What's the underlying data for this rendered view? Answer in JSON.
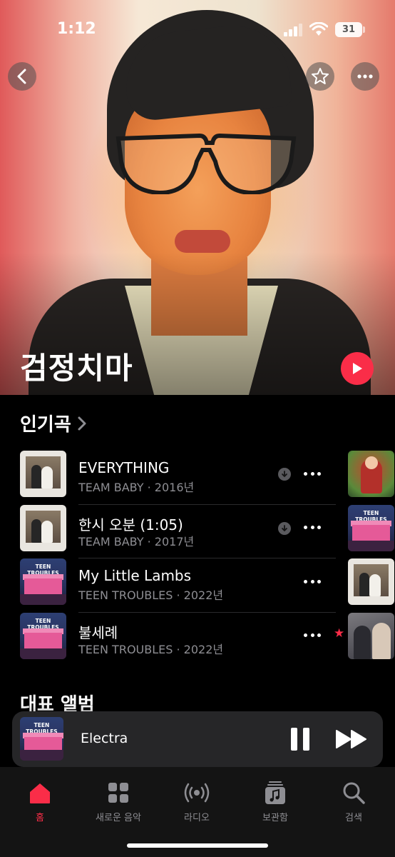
{
  "status_bar": {
    "time": "1:12",
    "battery": "31"
  },
  "artist": {
    "name": "검정치마"
  },
  "popular": {
    "title": "인기곡",
    "songs": [
      {
        "title": "EVERYTHING",
        "subtitle": "TEAM BABY · 2016년",
        "downloaded": true,
        "favorite": false,
        "art": "wedding"
      },
      {
        "title": "한시 오분 (1:05)",
        "subtitle": "TEAM BABY · 2017년",
        "downloaded": true,
        "favorite": false,
        "art": "wedding"
      },
      {
        "title": "My Little Lambs",
        "subtitle": "TEEN TROUBLES · 2022년",
        "downloaded": false,
        "favorite": false,
        "art": "teen"
      },
      {
        "title": "불세례",
        "subtitle": "TEEN TROUBLES · 2022년",
        "downloaded": false,
        "favorite": true,
        "art": "teen"
      }
    ],
    "favorite_glyph": "★",
    "album_art_label": "TEEN TROUBLES"
  },
  "albums": {
    "title": "대표 앨범"
  },
  "mini_player": {
    "title": "Electra"
  },
  "tabs": [
    {
      "label": "홈",
      "icon": "house-icon",
      "active": true
    },
    {
      "label": "새로운 음악",
      "icon": "grid-icon",
      "active": false
    },
    {
      "label": "라디오",
      "icon": "radio-waves-icon",
      "active": false
    },
    {
      "label": "보관함",
      "icon": "music-library-icon",
      "active": false
    },
    {
      "label": "검색",
      "icon": "search-icon",
      "active": false
    }
  ],
  "colors": {
    "accent": "#fa2d48",
    "background": "#000000",
    "secondary_text": "#8e8e93",
    "mini_player_bg": "#262628"
  }
}
